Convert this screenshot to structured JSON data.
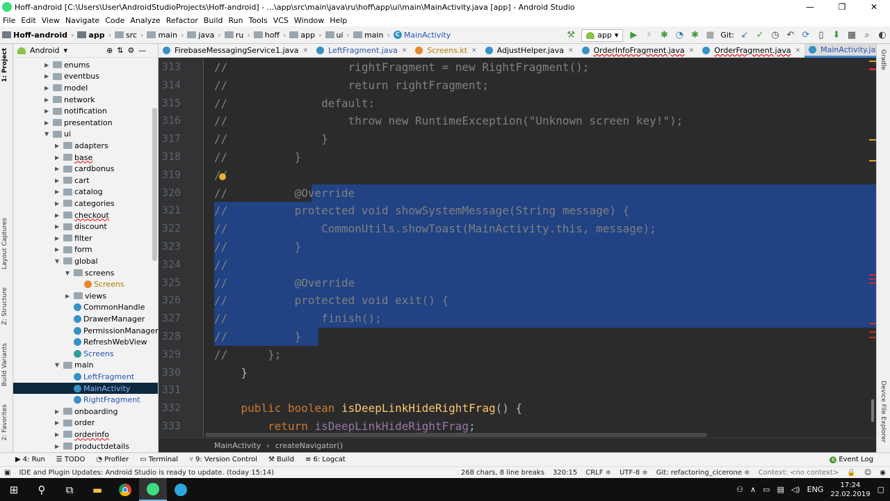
{
  "window": {
    "title": "Hoff-android [C:\\Users\\User\\AndroidStudioProjects\\Hoff-android] - ...\\app\\src\\main\\java\\ru\\hoff\\app\\ui\\main\\MainActivity.java [app] - Android Studio",
    "minimize": "—",
    "maximize": "❐",
    "close": "✕"
  },
  "menu": [
    "File",
    "Edit",
    "View",
    "Navigate",
    "Code",
    "Analyze",
    "Refactor",
    "Build",
    "Run",
    "Tools",
    "VCS",
    "Window",
    "Help"
  ],
  "navbar": {
    "crumbs": [
      "Hoff-android",
      "app",
      "src",
      "main",
      "java",
      "ru",
      "hoff",
      "app",
      "ui",
      "main",
      "MainActivity"
    ],
    "run_config": "app",
    "git_label": "Git:"
  },
  "project": {
    "view": "Android",
    "tree": [
      {
        "label": "enums",
        "level": 3,
        "type": "folder",
        "arrow": "▶",
        "state": ""
      },
      {
        "label": "eventbus",
        "level": 3,
        "type": "folder",
        "arrow": "▶",
        "state": ""
      },
      {
        "label": "model",
        "level": 3,
        "type": "folder",
        "arrow": "▶",
        "state": ""
      },
      {
        "label": "network",
        "level": 3,
        "type": "folder",
        "arrow": "▶",
        "state": ""
      },
      {
        "label": "notification",
        "level": 3,
        "type": "folder",
        "arrow": "▶",
        "state": ""
      },
      {
        "label": "presentation",
        "level": 3,
        "type": "folder",
        "arrow": "▶",
        "state": ""
      },
      {
        "label": "ui",
        "level": 3,
        "type": "folder",
        "arrow": "▼",
        "state": ""
      },
      {
        "label": "adapters",
        "level": 4,
        "type": "folder",
        "arrow": "▶",
        "state": ""
      },
      {
        "label": "base",
        "level": 4,
        "type": "folder",
        "arrow": "▶",
        "state": "red"
      },
      {
        "label": "cardbonus",
        "level": 4,
        "type": "folder",
        "arrow": "▶",
        "state": ""
      },
      {
        "label": "cart",
        "level": 4,
        "type": "folder",
        "arrow": "▶",
        "state": ""
      },
      {
        "label": "catalog",
        "level": 4,
        "type": "folder",
        "arrow": "▶",
        "state": ""
      },
      {
        "label": "categories",
        "level": 4,
        "type": "folder",
        "arrow": "▶",
        "state": ""
      },
      {
        "label": "checkout",
        "level": 4,
        "type": "folder",
        "arrow": "▶",
        "state": "red"
      },
      {
        "label": "discount",
        "level": 4,
        "type": "folder",
        "arrow": "▶",
        "state": ""
      },
      {
        "label": "filter",
        "level": 4,
        "type": "folder",
        "arrow": "▶",
        "state": ""
      },
      {
        "label": "form",
        "level": 4,
        "type": "folder",
        "arrow": "▶",
        "state": ""
      },
      {
        "label": "global",
        "level": 4,
        "type": "folder",
        "arrow": "▼",
        "state": ""
      },
      {
        "label": "screens",
        "level": 5,
        "type": "folder",
        "arrow": "▼",
        "state": ""
      },
      {
        "label": "Screens",
        "level": 6,
        "type": "kotlin",
        "arrow": "",
        "state": "gold"
      },
      {
        "label": "views",
        "level": 5,
        "type": "folder",
        "arrow": "▶",
        "state": ""
      },
      {
        "label": "CommonHandle",
        "level": 5,
        "type": "class",
        "arrow": "",
        "state": ""
      },
      {
        "label": "DrawerManager",
        "level": 5,
        "type": "class",
        "arrow": "",
        "state": ""
      },
      {
        "label": "PermissionManager",
        "level": 5,
        "type": "class",
        "arrow": "",
        "state": ""
      },
      {
        "label": "RefreshWebView",
        "level": 5,
        "type": "class",
        "arrow": "",
        "state": ""
      },
      {
        "label": "Screens",
        "level": 5,
        "type": "iface",
        "arrow": "",
        "state": "blue"
      },
      {
        "label": "main",
        "level": 4,
        "type": "folder",
        "arrow": "▼",
        "state": ""
      },
      {
        "label": "LeftFragment",
        "level": 5,
        "type": "class",
        "arrow": "",
        "state": "blue"
      },
      {
        "label": "MainActivity",
        "level": 5,
        "type": "class",
        "arrow": "",
        "state": "sel"
      },
      {
        "label": "RightFragment",
        "level": 5,
        "type": "class",
        "arrow": "",
        "state": "blue"
      },
      {
        "label": "onboarding",
        "level": 4,
        "type": "folder",
        "arrow": "▶",
        "state": ""
      },
      {
        "label": "order",
        "level": 4,
        "type": "folder",
        "arrow": "▶",
        "state": ""
      },
      {
        "label": "orderinfo",
        "level": 4,
        "type": "folder",
        "arrow": "▶",
        "state": "red"
      },
      {
        "label": "productdetails",
        "level": 4,
        "type": "folder",
        "arrow": "▶",
        "state": ""
      }
    ]
  },
  "side_tools": {
    "left": [
      "1: Project",
      "Layout Captures",
      "Z: Structure",
      "Build Variants",
      "2: Favorites"
    ],
    "right": [
      "Gradle",
      "Device File Explorer"
    ]
  },
  "tabs": [
    {
      "label": "FirebaseMessagingService1.java",
      "icon": "class",
      "style": ""
    },
    {
      "label": "LeftFragment.java",
      "icon": "class",
      "style": "blue"
    },
    {
      "label": "Screens.kt",
      "icon": "kotlin",
      "style": "gold"
    },
    {
      "label": "AdjustHelper.java",
      "icon": "class",
      "style": ""
    },
    {
      "label": "OrderInfoFragment.java",
      "icon": "class",
      "style": "red"
    },
    {
      "label": "OrderFragment.java",
      "icon": "class",
      "style": "red"
    },
    {
      "label": "MainActivity.java",
      "icon": "class",
      "style": "active"
    }
  ],
  "editor": {
    "lines": [
      {
        "n": "313",
        "text": "//                  rightFragment = new RightFragment();",
        "kind": "comment",
        "sel": ""
      },
      {
        "n": "314",
        "text": "//                  return rightFragment;",
        "kind": "comment",
        "sel": ""
      },
      {
        "n": "315",
        "text": "//              default:",
        "kind": "comment",
        "sel": ""
      },
      {
        "n": "316",
        "text": "//                  throw new RuntimeException(\"Unknown screen key!\");",
        "kind": "comment",
        "sel": ""
      },
      {
        "n": "317",
        "text": "//              }",
        "kind": "comment",
        "sel": ""
      },
      {
        "n": "318",
        "text": "//          }",
        "kind": "comment",
        "sel": ""
      },
      {
        "n": "319",
        "text": "//",
        "kind": "comment",
        "sel": ""
      },
      {
        "n": "320",
        "text": "//          @Override",
        "kind": "comment",
        "sel": "partial"
      },
      {
        "n": "321",
        "text": "//          protected void showSystemMessage(String message) {",
        "kind": "comment",
        "sel": "full"
      },
      {
        "n": "322",
        "text": "//              CommonUtils.showToast(MainActivity.this, message);",
        "kind": "comment",
        "sel": "full"
      },
      {
        "n": "323",
        "text": "//          }",
        "kind": "comment",
        "sel": "full"
      },
      {
        "n": "324",
        "text": "//",
        "kind": "comment",
        "sel": "full"
      },
      {
        "n": "325",
        "text": "//          @Override",
        "kind": "comment",
        "sel": "full"
      },
      {
        "n": "326",
        "text": "//          protected void exit() {",
        "kind": "comment",
        "sel": "full"
      },
      {
        "n": "327",
        "text": "//              finish();",
        "kind": "comment",
        "sel": "full"
      },
      {
        "n": "328",
        "text": "//          }",
        "kind": "comment",
        "sel": "end"
      },
      {
        "n": "329",
        "text": "//      };",
        "kind": "comment",
        "sel": ""
      },
      {
        "n": "330",
        "text": "    }",
        "kind": "normal",
        "sel": ""
      },
      {
        "n": "331",
        "text": "",
        "kind": "normal",
        "sel": ""
      },
      {
        "n": "332",
        "text": "    public boolean isDeepLinkHideRightFrag() {",
        "kind": "decl",
        "sel": ""
      },
      {
        "n": "333",
        "text": "        return isDeepLinkHideRightFrag;",
        "kind": "ret",
        "sel": ""
      }
    ],
    "breadcrumb": [
      "MainActivity",
      "createNavigator()"
    ]
  },
  "toolwindows": [
    {
      "label": "4: Run",
      "icon": "▶"
    },
    {
      "label": "TODO",
      "icon": "☰"
    },
    {
      "label": "Profiler",
      "icon": "◔"
    },
    {
      "label": "Terminal",
      "icon": "▭"
    },
    {
      "label": "9: Version Control",
      "icon": "⑂"
    },
    {
      "label": "Build",
      "icon": "⚒"
    },
    {
      "label": "6: Logcat",
      "icon": "≡"
    }
  ],
  "event_log": "Event Log",
  "event_count": "6",
  "status": {
    "message": "IDE and Plugin Updates: Android Studio is ready to update. (today 15:14)",
    "chars": "268 chars, 8 line breaks",
    "pos": "320:15",
    "crlf": "CRLF ≑",
    "enc": "UTF-8 ≑",
    "git": "Git: refactoring_cicerone ≑",
    "context": "Context: <no context>"
  },
  "taskbar": {
    "lang": "ENG",
    "time": "17:24",
    "date": "22.02.2019"
  },
  "colors": {
    "accent": "#4083c9",
    "selection": "#214283",
    "comment": "#808080",
    "keyword": "#cc7832",
    "function": "#ffc66d",
    "field": "#9876aa"
  }
}
